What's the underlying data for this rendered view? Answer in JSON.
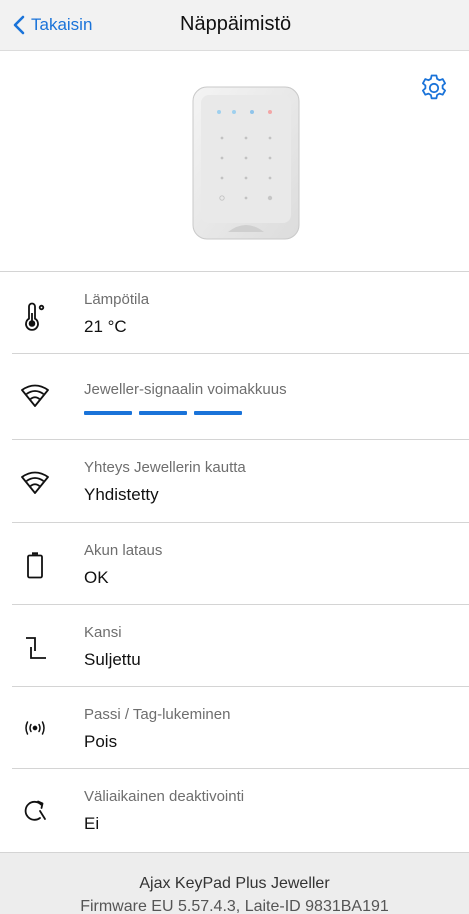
{
  "navbar": {
    "back_label": "Takaisin",
    "title": "Näppäimistö"
  },
  "hero": {
    "device_icon": "keypad-device-image",
    "settings_icon": "gear-icon"
  },
  "rows": [
    {
      "label": "Lämpötila",
      "value": "21 °C",
      "icon": "thermometer-icon"
    },
    {
      "label": "Jeweller-signaalin voimakkuus",
      "icon": "wifi-signal-icon",
      "signal_level": 3,
      "signal_max": 3
    },
    {
      "label": "Yhteys Jewellerin kautta",
      "value": "Yhdistetty",
      "icon": "wifi-signal-icon"
    },
    {
      "label": "Akun lataus",
      "value": "OK",
      "icon": "battery-icon"
    },
    {
      "label": "Kansi",
      "value": "Suljettu",
      "icon": "lid-icon"
    },
    {
      "label": "Passi / Tag-lukeminen",
      "value": "Pois",
      "icon": "rfid-icon"
    },
    {
      "label": "Väliaikainen deaktivointi",
      "value": "Ei",
      "icon": "deactivation-icon"
    }
  ],
  "footer": {
    "model": "Ajax KeyPad Plus Jeweller",
    "firmware": "Firmware EU 5.57.4.3, Laite-ID 9831BA191"
  },
  "colors": {
    "accent": "#1a73d9",
    "navbar_bg": "#f2f2f2",
    "footer_bg": "#ededed"
  }
}
